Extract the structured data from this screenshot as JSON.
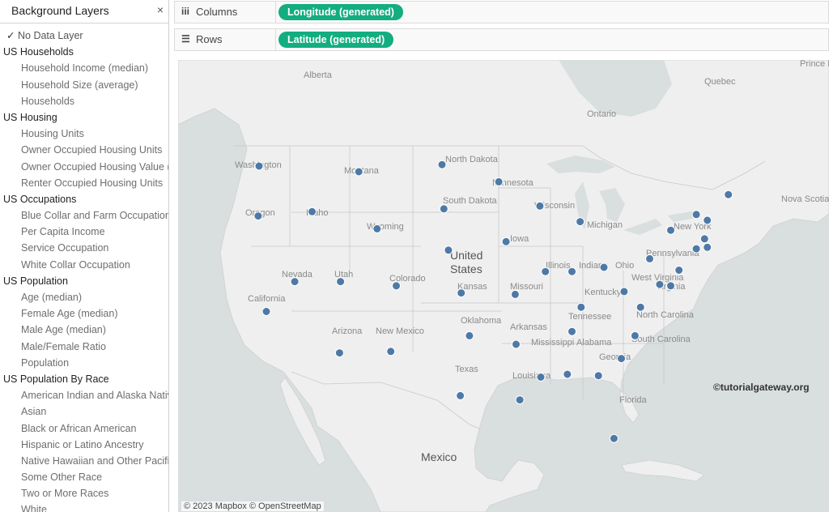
{
  "sidebar": {
    "title": "Background Layers",
    "close_glyph": "×",
    "check_glyph": "✓",
    "no_data_label": "No Data Layer",
    "groups": [
      {
        "label": "US Households",
        "items": [
          "Household Income (median)",
          "Household Size (average)",
          "Households"
        ]
      },
      {
        "label": "US Housing",
        "items": [
          "Housing Units",
          "Owner Occupied Housing Units",
          "Owner Occupied Housing Value (",
          "Renter Occupied Housing Units"
        ]
      },
      {
        "label": "US Occupations",
        "items": [
          "Blue Collar and Farm Occupation",
          "Per Capita Income",
          "Service Occupation",
          "White Collar Occupation"
        ]
      },
      {
        "label": "US Population",
        "items": [
          "Age (median)",
          "Female Age (median)",
          "Male Age (median)",
          "Male/Female Ratio",
          "Population"
        ]
      },
      {
        "label": "US Population By Race",
        "items": [
          "American Indian and Alaska Nativ",
          "Asian",
          "Black or African American",
          "Hispanic or Latino Ancestry",
          "Native Hawaiian and Other Pacific",
          "Some Other Race",
          "Two or More Races",
          "White"
        ]
      }
    ]
  },
  "shelves": {
    "columns": {
      "icon": "iii",
      "label": "Columns",
      "pill": "Longitude (generated)"
    },
    "rows": {
      "icon": "☰",
      "label": "Rows",
      "pill": "Latitude (generated)"
    }
  },
  "colors": {
    "pill": "#13ad80",
    "marker": "#4e79a7",
    "land": "#efefef",
    "water": "#d9dedf"
  },
  "map": {
    "country_labels": [
      "United",
      "States",
      "Mexico"
    ],
    "place_labels": [
      "Alberta",
      "Quebec",
      "Ontario",
      "Nova Scotia",
      "Prince Edward Island",
      "Washington",
      "Montana",
      "North Dakota",
      "Minnesota",
      "South Dakota",
      "Oregon",
      "Idaho",
      "Wyoming",
      "Wisconsin",
      "Michigan",
      "New York",
      "Iowa",
      "Illinois",
      "Indiana",
      "Ohio",
      "Pennsylvania",
      "Nevada",
      "Utah",
      "Colorado",
      "Kansas",
      "Missouri",
      "Kentucky",
      "West Virginia",
      "Virginia",
      "California",
      "Oklahoma",
      "Arkansas",
      "Tennessee",
      "North Carolina",
      "Arizona",
      "New Mexico",
      "Texas",
      "Mississippi",
      "Alabama",
      "Georgia",
      "South Carolina",
      "Louisiana",
      "Florida"
    ],
    "watermark": "©tutorialgateway.org",
    "attribution": "© 2023 Mapbox © OpenStreetMap",
    "points": [
      {
        "state": "Washington",
        "lon": -120.5,
        "lat": 47.4
      },
      {
        "state": "Oregon",
        "lon": -120.6,
        "lat": 43.9
      },
      {
        "state": "California",
        "lon": -119.7,
        "lat": 37.2
      },
      {
        "state": "Nevada",
        "lon": -116.6,
        "lat": 39.3
      },
      {
        "state": "Idaho",
        "lon": -114.7,
        "lat": 44.2
      },
      {
        "state": "Montana",
        "lon": -109.6,
        "lat": 47.0
      },
      {
        "state": "Utah",
        "lon": -111.6,
        "lat": 39.3
      },
      {
        "state": "Arizona",
        "lon": -111.7,
        "lat": 34.3
      },
      {
        "state": "Wyoming",
        "lon": -107.6,
        "lat": 43.0
      },
      {
        "state": "Colorado",
        "lon": -105.5,
        "lat": 39.0
      },
      {
        "state": "New Mexico",
        "lon": -106.1,
        "lat": 34.4
      },
      {
        "state": "North Dakota",
        "lon": -100.5,
        "lat": 47.5
      },
      {
        "state": "South Dakota",
        "lon": -100.3,
        "lat": 44.4
      },
      {
        "state": "Nebraska",
        "lon": -99.8,
        "lat": 41.5
      },
      {
        "state": "Kansas",
        "lon": -98.4,
        "lat": 38.5
      },
      {
        "state": "Oklahoma",
        "lon": -97.5,
        "lat": 35.5
      },
      {
        "state": "Texas",
        "lon": -98.5,
        "lat": 31.3
      },
      {
        "state": "Minnesota",
        "lon": -94.3,
        "lat": 46.3
      },
      {
        "state": "Iowa",
        "lon": -93.5,
        "lat": 42.1
      },
      {
        "state": "Missouri",
        "lon": -92.5,
        "lat": 38.4
      },
      {
        "state": "Arkansas",
        "lon": -92.4,
        "lat": 34.9
      },
      {
        "state": "Louisiana",
        "lon": -92.0,
        "lat": 31.0
      },
      {
        "state": "Wisconsin",
        "lon": -89.8,
        "lat": 44.6
      },
      {
        "state": "Illinois",
        "lon": -89.2,
        "lat": 40.0
      },
      {
        "state": "Mississippi",
        "lon": -89.7,
        "lat": 32.6
      },
      {
        "state": "Indiana",
        "lon": -86.3,
        "lat": 40.0
      },
      {
        "state": "Kentucky",
        "lon": -85.3,
        "lat": 37.5
      },
      {
        "state": "Tennessee",
        "lon": -86.3,
        "lat": 35.8
      },
      {
        "state": "Alabama",
        "lon": -86.8,
        "lat": 32.8
      },
      {
        "state": "Michigan",
        "lon": -85.4,
        "lat": 43.5
      },
      {
        "state": "Ohio",
        "lon": -82.8,
        "lat": 40.3
      },
      {
        "state": "Georgia",
        "lon": -83.4,
        "lat": 32.7
      },
      {
        "state": "Florida",
        "lon": -81.7,
        "lat": 28.3
      },
      {
        "state": "South Carolina",
        "lon": -80.9,
        "lat": 33.9
      },
      {
        "state": "North Carolina",
        "lon": -79.4,
        "lat": 35.5
      },
      {
        "state": "West Virginia",
        "lon": -80.6,
        "lat": 38.6
      },
      {
        "state": "Virginia",
        "lon": -78.8,
        "lat": 37.5
      },
      {
        "state": "Pennsylvania",
        "lon": -77.8,
        "lat": 40.9
      },
      {
        "state": "New York",
        "lon": -75.5,
        "lat": 42.9
      },
      {
        "state": "Maryland",
        "lon": -76.7,
        "lat": 39.1
      },
      {
        "state": "Delaware",
        "lon": -75.5,
        "lat": 39.0
      },
      {
        "state": "New Jersey",
        "lon": -74.6,
        "lat": 40.1
      },
      {
        "state": "Connecticut",
        "lon": -72.7,
        "lat": 41.6
      },
      {
        "state": "Rhode Island",
        "lon": -71.5,
        "lat": 41.7
      },
      {
        "state": "Massachusetts",
        "lon": -71.8,
        "lat": 42.3
      },
      {
        "state": "Vermont",
        "lon": -72.7,
        "lat": 44.0
      },
      {
        "state": "New Hampshire",
        "lon": -71.5,
        "lat": 43.6
      },
      {
        "state": "Maine",
        "lon": -69.2,
        "lat": 45.4
      }
    ]
  }
}
